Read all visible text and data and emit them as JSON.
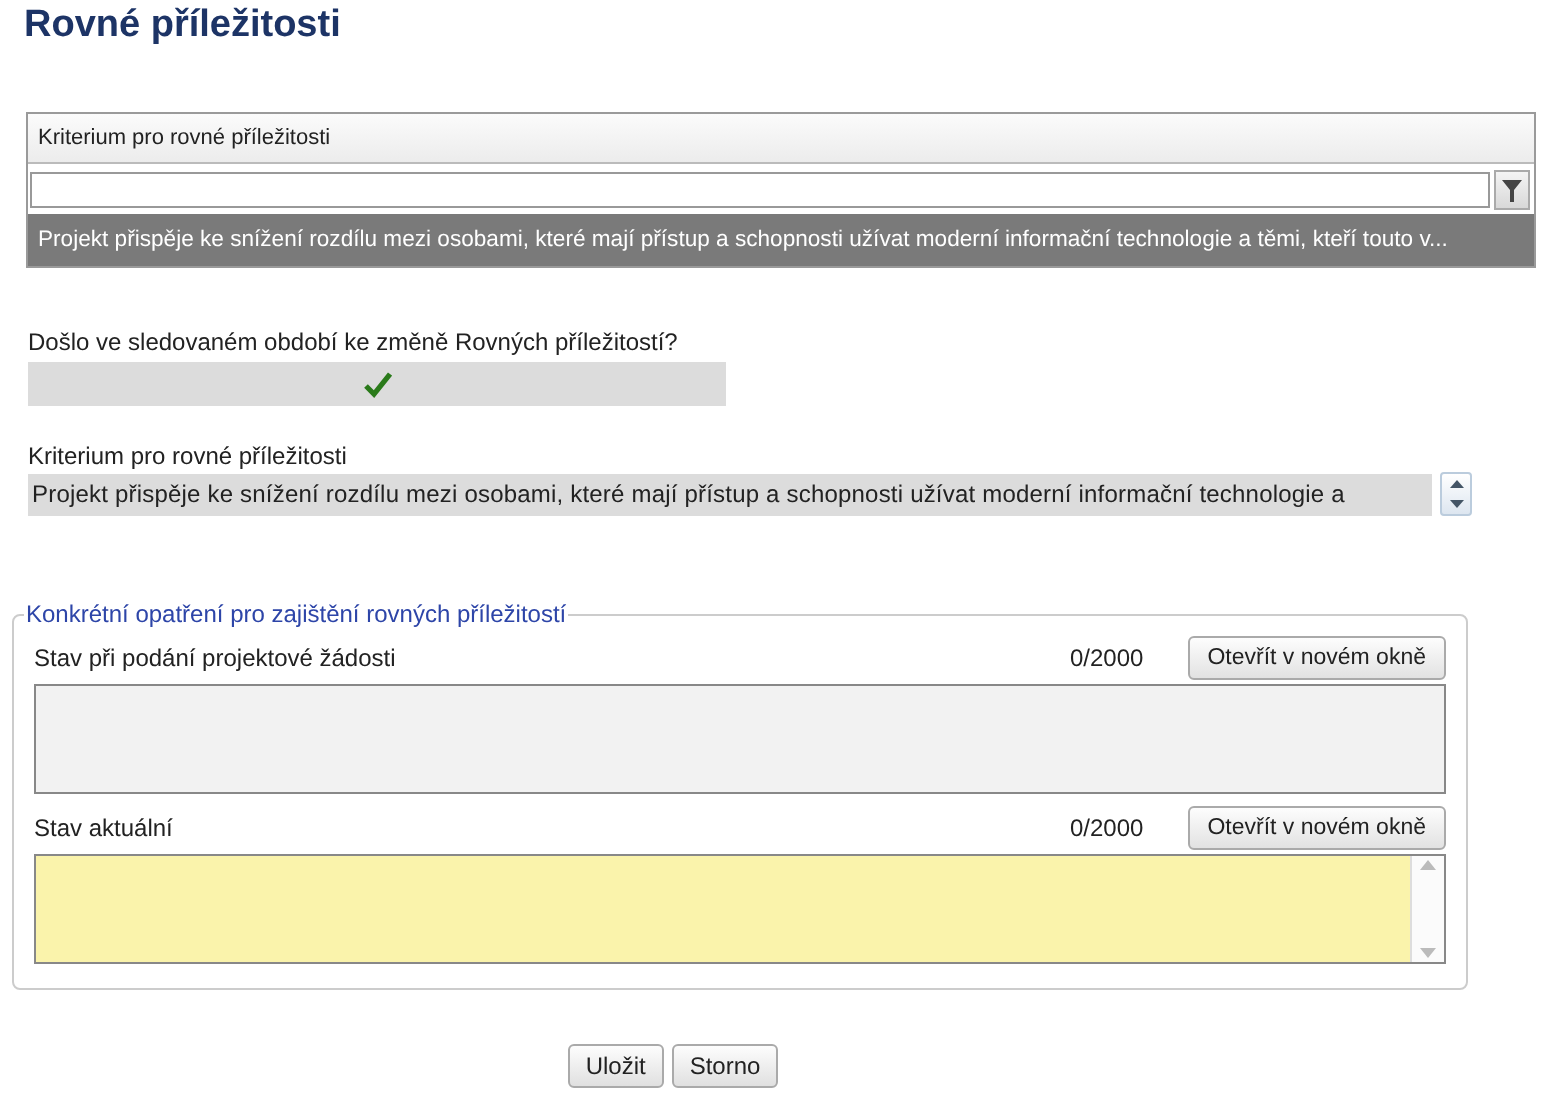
{
  "title": "Rovné příležitosti",
  "grid": {
    "column": "Kriterium pro rovné příležitosti",
    "rows": [
      {
        "text": "Projekt přispěje ke snížení rozdílu mezi osobami, které mají přístup a schopnosti užívat moderní informační technologie a těmi, kteří touto v...",
        "selected": true
      }
    ]
  },
  "question": {
    "label": "Došlo ve sledovaném období ke změně Rovných příležitostí?",
    "checked": true
  },
  "criterion": {
    "label": "Kriterium pro rovné příležitosti",
    "value": "Projekt přispěje ke snížení rozdílu mezi osobami, které mají přístup a schopnosti užívat moderní informační technologie a"
  },
  "fieldset": {
    "legend": "Konkrétní opatření pro zajištění rovných příležitostí",
    "fields": [
      {
        "label": "Stav při podání projektové žádosti",
        "counter": "0/2000",
        "button": "Otevřít v novém okně",
        "kind": "readonly"
      },
      {
        "label": "Stav aktuální",
        "counter": "0/2000",
        "button": "Otevřít v novém okně",
        "kind": "editable"
      }
    ]
  },
  "buttons": [
    "Uložit",
    "Storno"
  ]
}
